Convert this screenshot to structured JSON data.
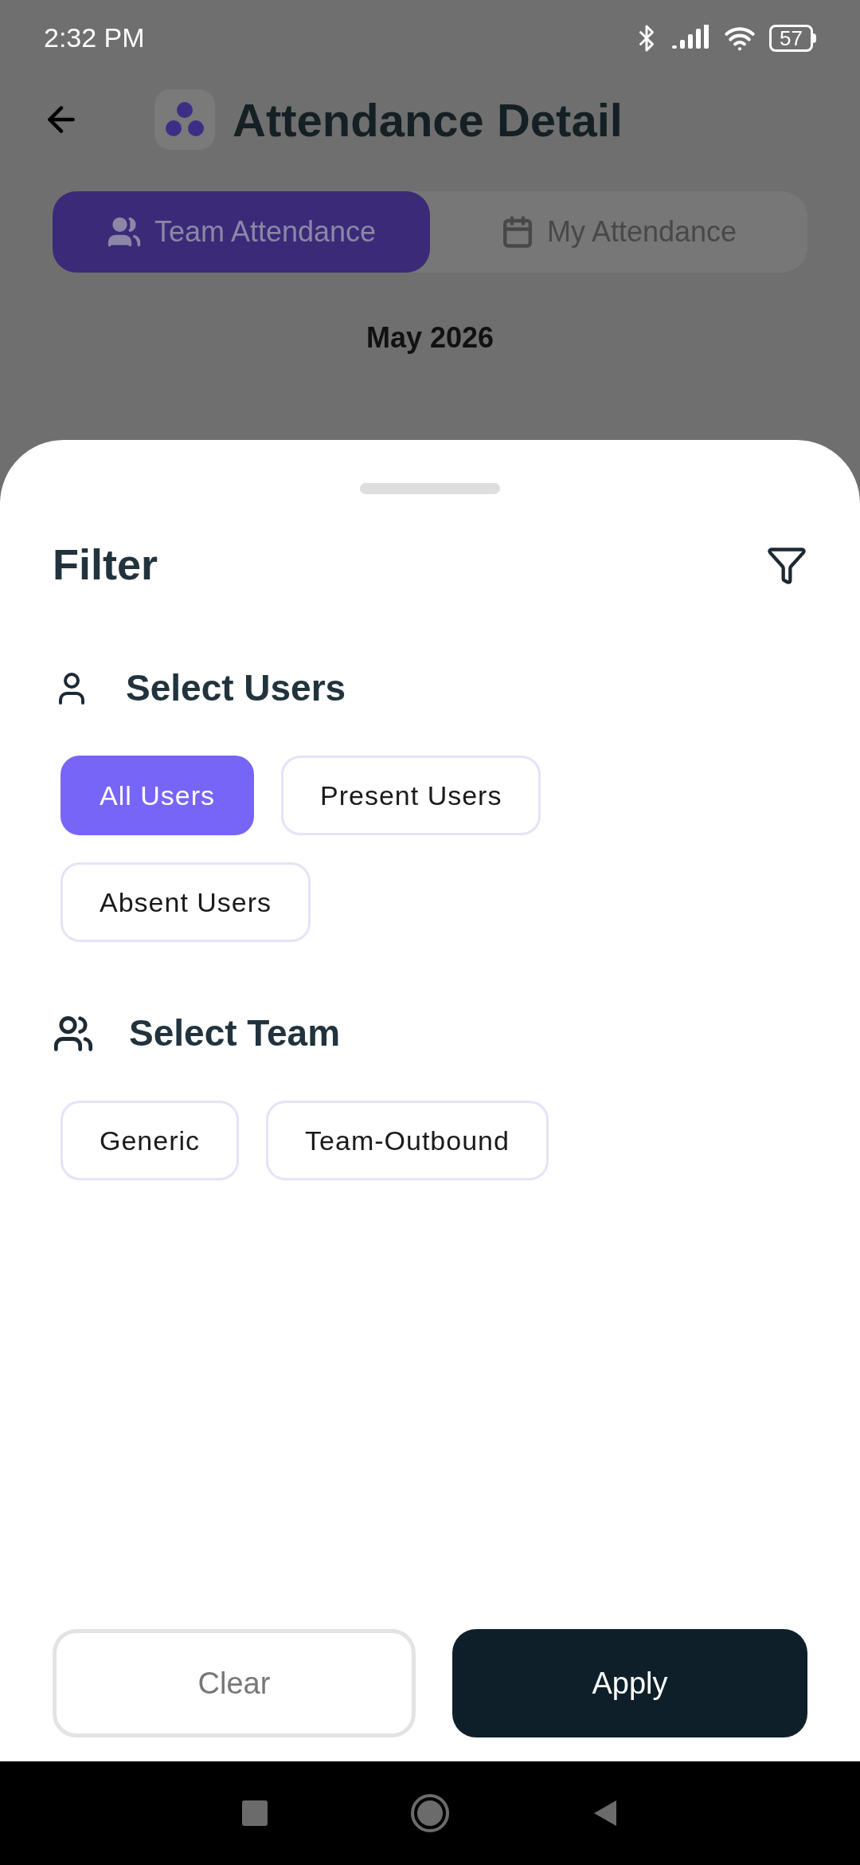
{
  "status_bar": {
    "time": "2:32 PM",
    "battery": "57"
  },
  "header": {
    "title": "Attendance Detail"
  },
  "tabs": [
    {
      "label": "Team Attendance",
      "selected": true,
      "kind": "team"
    },
    {
      "label": "My Attendance",
      "selected": false,
      "kind": "calendar"
    }
  ],
  "month": "May 2026",
  "sheet": {
    "title": "Filter",
    "sections": [
      {
        "title": "Select Users",
        "kind": "user",
        "options": [
          {
            "label": "All Users",
            "selected": true
          },
          {
            "label": "Present Users",
            "selected": false
          },
          {
            "label": "Absent Users",
            "selected": false
          }
        ]
      },
      {
        "title": "Select Team",
        "kind": "team",
        "options": [
          {
            "label": "Generic",
            "selected": false
          },
          {
            "label": "Team-Outbound",
            "selected": false
          }
        ]
      }
    ],
    "buttons": [
      {
        "label": "Clear",
        "kind": "secondary"
      },
      {
        "label": "Apply",
        "kind": "primary"
      }
    ]
  }
}
